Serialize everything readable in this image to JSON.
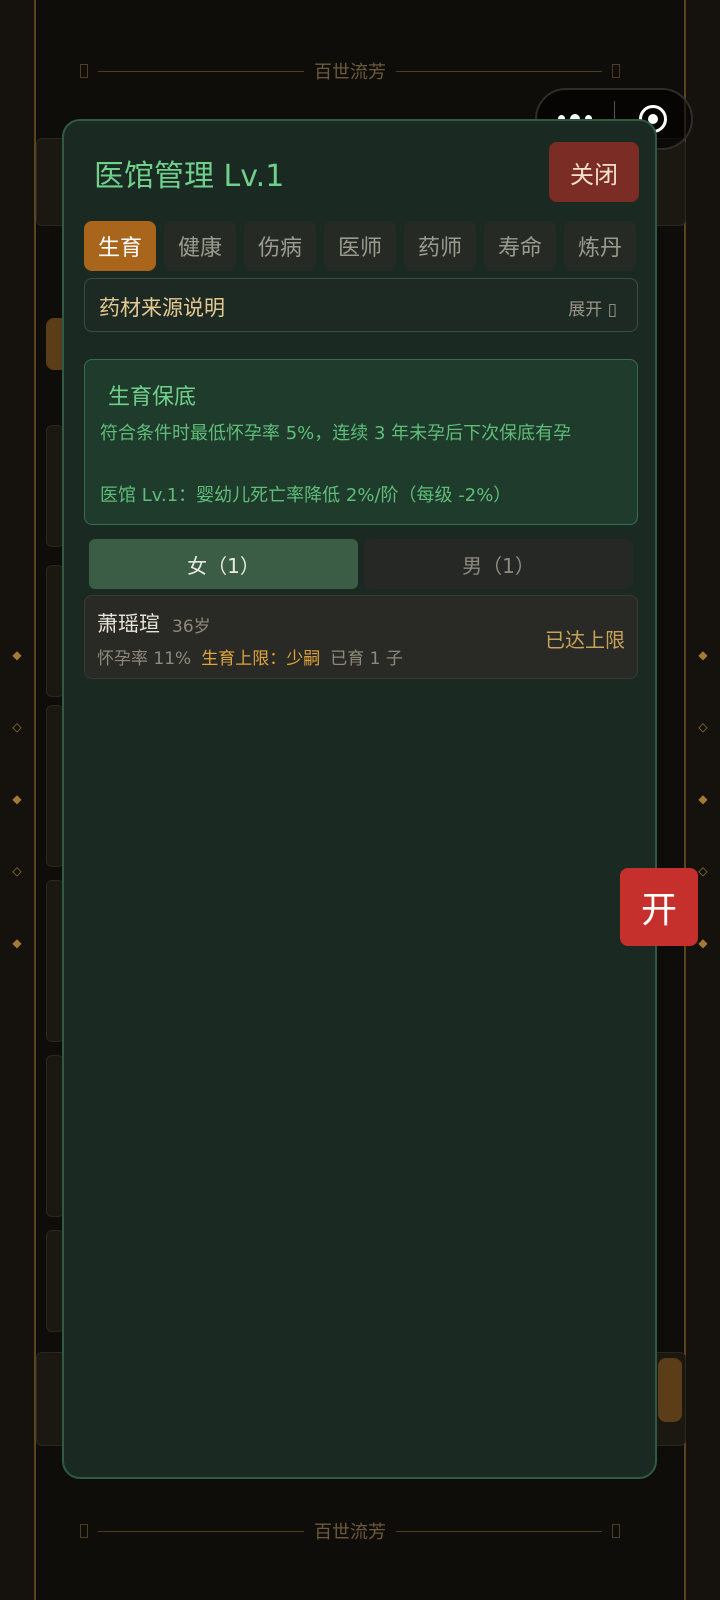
{
  "banner": {
    "text": "百世流芳"
  },
  "modal": {
    "title": "医馆管理 Lv.1",
    "close_label": "关闭",
    "tabs": [
      {
        "label": "生育",
        "active": true
      },
      {
        "label": "健康",
        "active": false
      },
      {
        "label": "伤病",
        "active": false
      },
      {
        "label": "医师",
        "active": false
      },
      {
        "label": "药师",
        "active": false
      },
      {
        "label": "寿命",
        "active": false
      },
      {
        "label": "炼丹",
        "active": false
      }
    ],
    "herb_source": {
      "title": "药材来源说明",
      "toggle_label": "展开 ▯"
    },
    "guarantee": {
      "title": "生育保底",
      "rule": "符合条件时最低怀孕率 5%，连续 3 年未孕后下次保底有孕",
      "effect": "医馆 Lv.1：婴幼儿死亡率降低 2%/阶（每级 -2%）"
    },
    "gender_tabs": [
      {
        "label": "女（1）",
        "active": true
      },
      {
        "label": "男（1）",
        "active": false
      }
    ],
    "people": [
      {
        "name": "萧瑶瑄",
        "age": "36岁",
        "pregnancy_rate": "怀孕率 11%",
        "birth_limit": "生育上限：少嗣",
        "children": "已育 1 子",
        "status": "已达上限"
      }
    ]
  },
  "open_button_label": "开",
  "colors": {
    "accent_green": "#6fcf8b",
    "active_tab": "#a9651c",
    "close_button": "#7b2c25",
    "open_button": "#c5302c",
    "gold_text": "#e0a43a"
  }
}
